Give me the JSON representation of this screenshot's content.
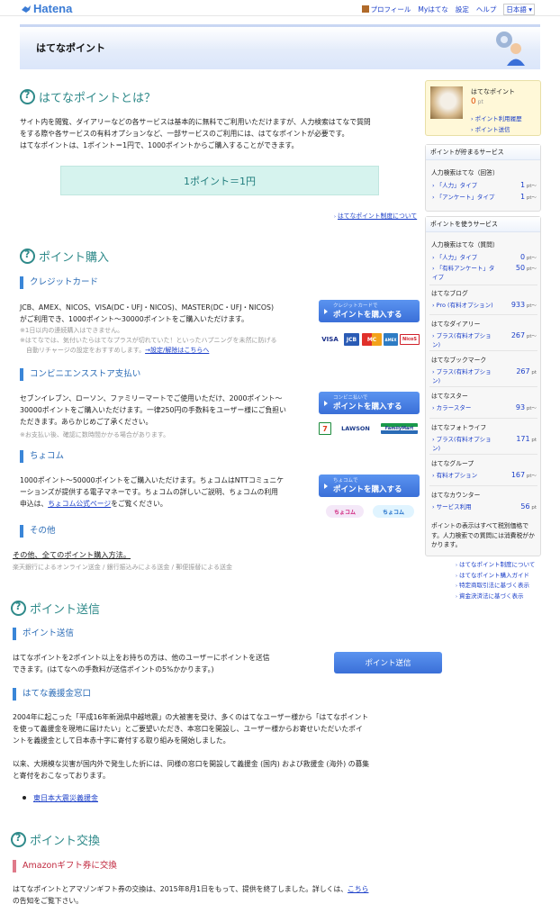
{
  "topbar": {
    "logo": "Hatena",
    "nav": [
      "プロフィール",
      "Myはてな",
      "設定",
      "ヘルプ",
      "日本語"
    ]
  },
  "header": {
    "title": "はてなポイント"
  },
  "about": {
    "title": "はてなポイントとは？",
    "text1": "サイト内を閲覧、ダイアリーなどの各サービスは基本的に無料でご利用いただけますが、人力検索はてなで質問",
    "text2": "をする際や各サービスの有料オプションなど、一部サービスのご利用には、はてなポイントが必要です。",
    "text3": "はてなポイントは、1ポイント＝1円で、1000ポイントからご購入することができます。",
    "rate": "1ポイント＝1円",
    "link": "はてなポイント制度について"
  },
  "purchase": {
    "title": "ポイント購入",
    "credit": {
      "title": "クレジットカード",
      "text1": "JCB、AMEX、NICOS、VISA(DC・UFJ・NICOS)、MASTER(DC・UFJ・NICOS)",
      "text2": "がご利用でき、1000ポイント〜30000ポイントをご購入いただけます。",
      "note1": "※1日以内の連続購入はできません。",
      "note2": "※はてなでは、気付いたらはてなプラスが切れていた！といったハプニングを未然に防げる",
      "note3": "　自動リチャージの設定をおすすめします。",
      "note_link": "→設定/解除はこちらへ",
      "btn_small": "クレジットカードで",
      "btn_large": "ポイントを購入する",
      "cards": [
        "VISA",
        "JCB",
        "MC",
        "AMEX",
        "NicoS"
      ]
    },
    "conveni": {
      "title": "コンビニエンスストア支払い",
      "text1": "セブンイレブン、ローソン、ファミリーマートでご使用いただけ、2000ポイント〜",
      "text2": "30000ポイントをご購入いただけます。一律250円の手数料をユーザー様にご負担い",
      "text3": "ただきます。あらかじめご了承ください。",
      "note": "※お支払い後、確認に数時間かかる場合があります。",
      "btn_small": "コンビニ払いで",
      "btn_large": "ポイントを購入する",
      "stores": [
        "7",
        "LAWSON",
        "FamilyMart"
      ]
    },
    "chocom": {
      "title": "ちょコム",
      "text1": "1000ポイント〜50000ポイントをご購入いただけます。ちょコムはNTTコミュニケ",
      "text2": "ーションズが提供する電子マネーです。ちょコムの詳しいご説明、ちょコムの利用",
      "text3a": "申込は、",
      "text3_link": "ちょコム公式ページ",
      "text3b": "をご覧ください。",
      "btn_small": "ちょコムで",
      "btn_large": "ポイントを購入する",
      "logos": [
        "ちょコム",
        "ちょコム"
      ]
    },
    "other": {
      "title": "その他",
      "link": "その他、全てのポイント購入方法。",
      "note": "楽天銀行によるオンライン送金 / 銀行振込みによる送金 / 郵便振替による送金"
    }
  },
  "send": {
    "title": "ポイント送信",
    "sub_title": "ポイント送信",
    "text1": "はてなポイントを2ポイント以上をお持ちの方は、他のユーザーにポイントを送信",
    "text2": "できます。(はてなへの手数料が送信ポイントの5%かかります。)",
    "btn": "ポイント送信",
    "donation": {
      "title": "はてな義援金窓口",
      "text1": "2004年に起こった「平成16年新潟県中越地震」の大被害を受け、多くのはてなユーザー様から「はてなポイント",
      "text2": "を使って義援金を現地に届けたい」とご要望いただき、本窓口を開設し、ユーザー様からお寄せいただいたポイ",
      "text3": "ントを義援金として日本赤十字に寄付する取り組みを開始しました。",
      "text4": "以来、大規模な災害が国内外で発生した折には、同様の窓口を開設して義援金 (国内) および救援金 (海外) の募集",
      "text5": "と寄付をおこなっております。",
      "item": "東日本大震災義援金"
    }
  },
  "exchange": {
    "title": "ポイント交換",
    "sub_title": "Amazonギフト券に交換",
    "text1a": "はてなポイントとアマゾンギフト券の交換は、2015年8月1日をもって、提供を終了しました。詳しくは、",
    "text1_link": "こちら",
    "text2": "の告知をご覧下さい。"
  },
  "sidebar": {
    "user": {
      "name": "はてなポイント",
      "points": "0",
      "unit": "pt",
      "link1": "ポイント利用履歴",
      "link2": "ポイント送信"
    },
    "earn": {
      "title": "ポイントが貯まるサービス",
      "group": "人力検索はてな（回答）",
      "rows": [
        {
          "label": "「人力」タイプ",
          "pt": "1",
          "unit": "pt〜"
        },
        {
          "label": "「アンケート」タイプ",
          "pt": "1",
          "unit": "pt〜"
        }
      ]
    },
    "use": {
      "title": "ポイントを使うサービス",
      "groups": [
        {
          "name": "人力検索はてな（質問）",
          "rows": [
            {
              "label": "「人力」タイプ",
              "pt": "0",
              "unit": "pt〜"
            },
            {
              "label": "「有料アンケート」タイプ",
              "pt": "50",
              "unit": "pt〜"
            }
          ]
        },
        {
          "name": "はてなブログ",
          "rows": [
            {
              "label": "Pro (有料オプション)",
              "pt": "933",
              "unit": "pt〜"
            }
          ]
        },
        {
          "name": "はてなダイアリー",
          "rows": [
            {
              "label": "プラス(有料オプション)",
              "pt": "267",
              "unit": "pt〜"
            }
          ]
        },
        {
          "name": "はてなブックマーク",
          "rows": [
            {
              "label": "プラス(有料オプション)",
              "pt": "267",
              "unit": "pt"
            }
          ]
        },
        {
          "name": "はてなスター",
          "rows": [
            {
              "label": "カラースター",
              "pt": "93",
              "unit": "pt〜"
            }
          ]
        },
        {
          "name": "はてなフォトライフ",
          "rows": [
            {
              "label": "プラス(有料オプション)",
              "pt": "171",
              "unit": "pt"
            }
          ]
        },
        {
          "name": "はてなグループ",
          "rows": [
            {
              "label": "有料オプション",
              "pt": "167",
              "unit": "pt〜"
            }
          ]
        },
        {
          "name": "はてなカウンター",
          "rows": [
            {
              "label": "サービス利用",
              "pt": "56",
              "unit": "pt"
            }
          ]
        }
      ],
      "footnote": "ポイントの表示はすべて税別価格です。人力検索での質問には消費税がかかります。"
    },
    "links": [
      "はてなポイント制度について",
      "はてなポイント購入ガイド",
      "特定商取引法に基づく表示",
      "資金決済法に基づく表示"
    ]
  }
}
